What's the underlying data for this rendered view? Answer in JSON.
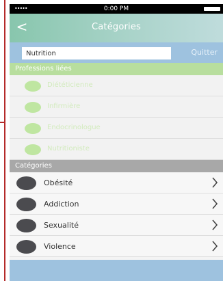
{
  "status_bar": {
    "signal": "•••••",
    "time": "0:00 PM"
  },
  "nav": {
    "back_icon": "<",
    "title": "Catégories"
  },
  "search": {
    "value": "Nutrition",
    "quit_label": "Quitter"
  },
  "sections": {
    "professions_title": "Professions liées",
    "categories_title": "Catégories"
  },
  "professions": [
    {
      "label": "Diététicienne"
    },
    {
      "label": "Infirmière"
    },
    {
      "label": "Endocrinologue"
    },
    {
      "label": "Nutritioniste"
    }
  ],
  "categories": [
    {
      "label": "Obésité"
    },
    {
      "label": "Addiction"
    },
    {
      "label": "Sexualité"
    },
    {
      "label": "Violence"
    }
  ],
  "colors": {
    "nav_green": "#88c6ad",
    "blue_bar": "#9ec2df",
    "professions_green": "#b8de9e",
    "category_gray": "#a8a8a8",
    "dark_dot": "#4b4b4f"
  },
  "icons": {
    "back": "back-arrow-icon",
    "chevron": "chevron-right-icon",
    "battery": "battery-icon"
  }
}
